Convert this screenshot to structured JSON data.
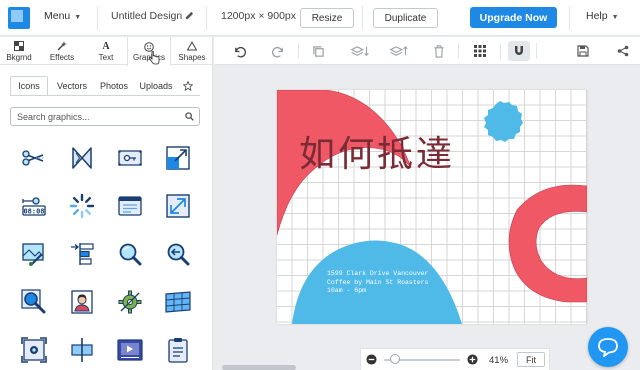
{
  "header": {
    "menu_label": "Menu",
    "title": "Untitled Design",
    "canvas_size": "1200px × 900px",
    "resize_label": "Resize",
    "duplicate_label": "Duplicate",
    "upgrade_label": "Upgrade Now",
    "help_label": "Help"
  },
  "sidebar": {
    "tabs": [
      "Bkgrnd",
      "Effects",
      "Text",
      "Graphics",
      "Shapes"
    ],
    "active_tab": "Graphics",
    "subtabs": [
      "Icons",
      "Vectors",
      "Photos",
      "Uploads"
    ],
    "active_subtab": "Icons",
    "search_placeholder": "Search graphics...",
    "icons": [
      [
        "scissors-icon",
        "hourglass-icon",
        "key-icon",
        "resize-corner-icon"
      ],
      [
        "timer-icon",
        "loading-spinner-icon",
        "browser-window-icon",
        "expand-arrow-icon"
      ],
      [
        "paint-brush-image-icon",
        "align-left-icon",
        "magnifier-icon",
        "zoom-back-icon"
      ],
      [
        "zoom-in-icon",
        "id-portrait-icon",
        "settings-cog-icon",
        "map-grid-icon"
      ],
      [
        "screenshot-frame-icon",
        "align-center-icon",
        "video-player-icon",
        "clipboard-icon"
      ]
    ]
  },
  "toolbar": {
    "buttons": [
      "undo-icon",
      "redo-icon",
      "copy-icon",
      "layer-down-icon",
      "layer-up-icon",
      "trash-icon",
      "grid-icon",
      "magnet-icon",
      "save-icon",
      "share-icon"
    ]
  },
  "canvas": {
    "heading": "如何抵達",
    "lines": [
      "1599 Clark Drive Vancouver",
      "Coffee by Main St Roasters",
      "10am - 6pm"
    ],
    "colors": {
      "coral": "#f05866",
      "sky": "#4fb9e8",
      "heading": "#7a2b35"
    }
  },
  "zoom": {
    "percent": "41%",
    "fit_label": "Fit",
    "level": 0.15
  },
  "colors": {
    "accent": "#1e88e5",
    "logo": "#2196f3"
  }
}
